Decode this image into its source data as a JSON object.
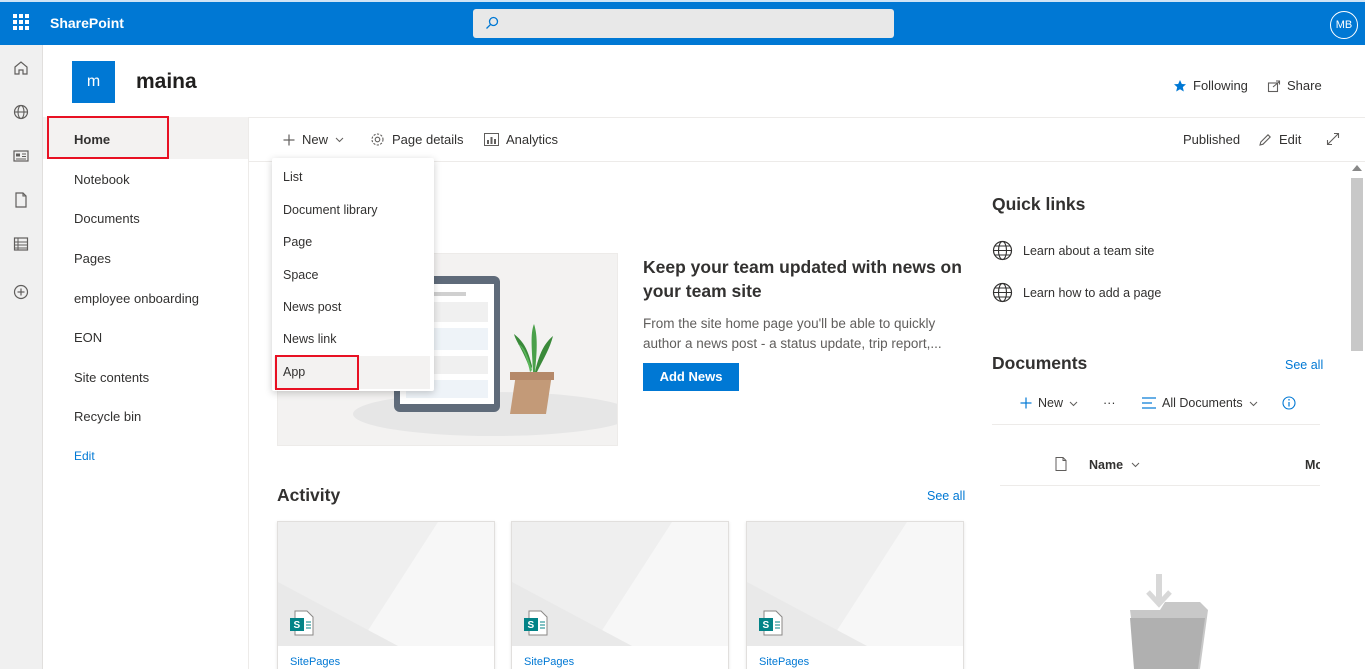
{
  "suitebar": {
    "brand": "SharePoint",
    "search_placeholder": "",
    "user_initials": "MB"
  },
  "site": {
    "logo_letter": "m",
    "title": "maina",
    "following_label": "Following",
    "share_label": "Share"
  },
  "leftnav": {
    "items": [
      "Home",
      "Notebook",
      "Documents",
      "Pages",
      "employee onboarding",
      "EON",
      "Site contents",
      "Recycle bin"
    ],
    "edit_label": "Edit"
  },
  "commandbar": {
    "new_label": "New",
    "page_details_label": "Page details",
    "analytics_label": "Analytics",
    "published_label": "Published",
    "edit_label": "Edit"
  },
  "new_menu": {
    "items": [
      "List",
      "Document library",
      "Page",
      "Space",
      "News post",
      "News link",
      "App"
    ]
  },
  "news": {
    "title": "Keep your team updated with news on your team site",
    "description": "From the site home page you'll be able to quickly author a news post - a status update, trip report,...",
    "add_button": "Add News"
  },
  "activity": {
    "title": "Activity",
    "see_all": "See all",
    "cards": [
      {
        "label": "SitePages"
      },
      {
        "label": "SitePages"
      },
      {
        "label": "SitePages"
      }
    ]
  },
  "quick_links": {
    "title": "Quick links",
    "items": [
      "Learn about a team site",
      "Learn how to add a page"
    ]
  },
  "documents": {
    "title": "Documents",
    "see_all": "See all",
    "new_label": "New",
    "more_label": "···",
    "view_label": "All Documents",
    "col_name": "Name",
    "col_modified": "Mo"
  },
  "colors": {
    "brand_blue": "#0078d4",
    "highlight_red": "#e81123"
  }
}
